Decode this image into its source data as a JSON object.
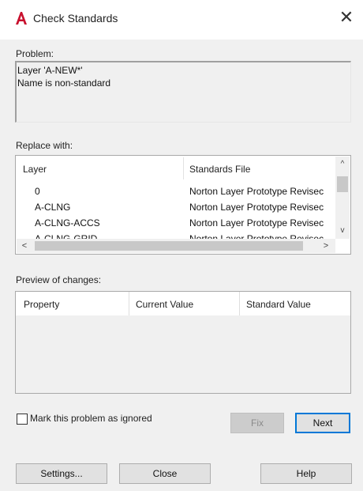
{
  "window": {
    "title": "Check Standards",
    "close_glyph": "✕",
    "logo_icon": "autocad-logo-icon",
    "accent_color": "#c8102e"
  },
  "problem": {
    "label": "Problem:",
    "lines": [
      "Layer 'A-NEW*'",
      "Name is non-standard"
    ]
  },
  "replace_with": {
    "label": "Replace with:",
    "columns": [
      "Layer",
      "Standards File"
    ],
    "rows": [
      {
        "layer": "0",
        "file": "Norton Layer Prototype Revisec"
      },
      {
        "layer": "A-CLNG",
        "file": "Norton Layer Prototype Revisec"
      },
      {
        "layer": "A-CLNG-ACCS",
        "file": "Norton Layer Prototype Revisec"
      },
      {
        "layer": "A-CLNG-GRID",
        "file": "Norton Layer Prototype Revisec"
      }
    ],
    "scroll_up": "^",
    "scroll_down": "v",
    "scroll_left": "<",
    "scroll_right": ">"
  },
  "preview": {
    "label": "Preview of changes:",
    "columns": [
      "Property",
      "Current Value",
      "Standard Value"
    ]
  },
  "ignore_checkbox": {
    "label": "Mark this problem as ignored",
    "checked": false
  },
  "buttons": {
    "fix": "Fix",
    "next": "Next",
    "settings": "Settings...",
    "close": "Close",
    "help": "Help"
  }
}
